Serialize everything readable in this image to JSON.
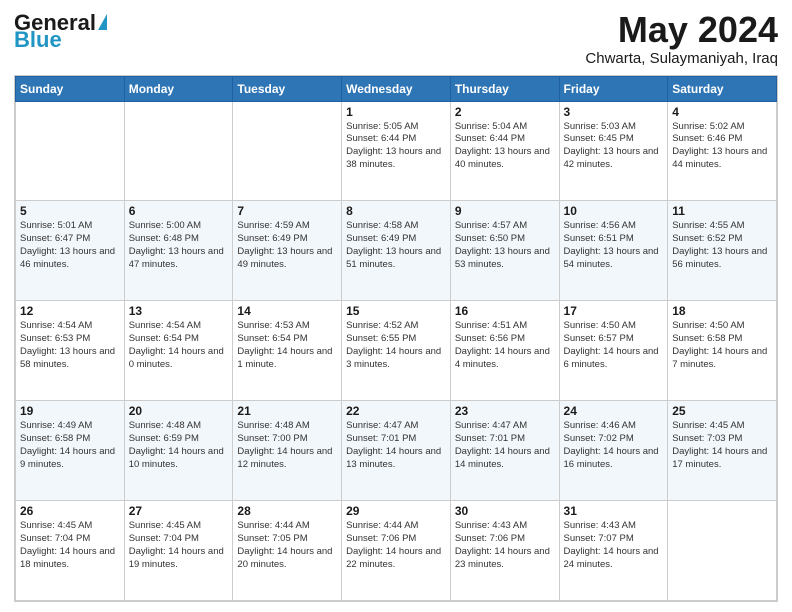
{
  "header": {
    "logo_general": "General",
    "logo_blue": "Blue",
    "month_title": "May 2024",
    "location": "Chwarta, Sulaymaniyah, Iraq"
  },
  "calendar": {
    "headers": [
      "Sunday",
      "Monday",
      "Tuesday",
      "Wednesday",
      "Thursday",
      "Friday",
      "Saturday"
    ],
    "rows": [
      [
        {
          "day": "",
          "info": ""
        },
        {
          "day": "",
          "info": ""
        },
        {
          "day": "",
          "info": ""
        },
        {
          "day": "1",
          "info": "Sunrise: 5:05 AM\nSunset: 6:44 PM\nDaylight: 13 hours and 38 minutes."
        },
        {
          "day": "2",
          "info": "Sunrise: 5:04 AM\nSunset: 6:44 PM\nDaylight: 13 hours and 40 minutes."
        },
        {
          "day": "3",
          "info": "Sunrise: 5:03 AM\nSunset: 6:45 PM\nDaylight: 13 hours and 42 minutes."
        },
        {
          "day": "4",
          "info": "Sunrise: 5:02 AM\nSunset: 6:46 PM\nDaylight: 13 hours and 44 minutes."
        }
      ],
      [
        {
          "day": "5",
          "info": "Sunrise: 5:01 AM\nSunset: 6:47 PM\nDaylight: 13 hours and 46 minutes."
        },
        {
          "day": "6",
          "info": "Sunrise: 5:00 AM\nSunset: 6:48 PM\nDaylight: 13 hours and 47 minutes."
        },
        {
          "day": "7",
          "info": "Sunrise: 4:59 AM\nSunset: 6:49 PM\nDaylight: 13 hours and 49 minutes."
        },
        {
          "day": "8",
          "info": "Sunrise: 4:58 AM\nSunset: 6:49 PM\nDaylight: 13 hours and 51 minutes."
        },
        {
          "day": "9",
          "info": "Sunrise: 4:57 AM\nSunset: 6:50 PM\nDaylight: 13 hours and 53 minutes."
        },
        {
          "day": "10",
          "info": "Sunrise: 4:56 AM\nSunset: 6:51 PM\nDaylight: 13 hours and 54 minutes."
        },
        {
          "day": "11",
          "info": "Sunrise: 4:55 AM\nSunset: 6:52 PM\nDaylight: 13 hours and 56 minutes."
        }
      ],
      [
        {
          "day": "12",
          "info": "Sunrise: 4:54 AM\nSunset: 6:53 PM\nDaylight: 13 hours and 58 minutes."
        },
        {
          "day": "13",
          "info": "Sunrise: 4:54 AM\nSunset: 6:54 PM\nDaylight: 14 hours and 0 minutes."
        },
        {
          "day": "14",
          "info": "Sunrise: 4:53 AM\nSunset: 6:54 PM\nDaylight: 14 hours and 1 minute."
        },
        {
          "day": "15",
          "info": "Sunrise: 4:52 AM\nSunset: 6:55 PM\nDaylight: 14 hours and 3 minutes."
        },
        {
          "day": "16",
          "info": "Sunrise: 4:51 AM\nSunset: 6:56 PM\nDaylight: 14 hours and 4 minutes."
        },
        {
          "day": "17",
          "info": "Sunrise: 4:50 AM\nSunset: 6:57 PM\nDaylight: 14 hours and 6 minutes."
        },
        {
          "day": "18",
          "info": "Sunrise: 4:50 AM\nSunset: 6:58 PM\nDaylight: 14 hours and 7 minutes."
        }
      ],
      [
        {
          "day": "19",
          "info": "Sunrise: 4:49 AM\nSunset: 6:58 PM\nDaylight: 14 hours and 9 minutes."
        },
        {
          "day": "20",
          "info": "Sunrise: 4:48 AM\nSunset: 6:59 PM\nDaylight: 14 hours and 10 minutes."
        },
        {
          "day": "21",
          "info": "Sunrise: 4:48 AM\nSunset: 7:00 PM\nDaylight: 14 hours and 12 minutes."
        },
        {
          "day": "22",
          "info": "Sunrise: 4:47 AM\nSunset: 7:01 PM\nDaylight: 14 hours and 13 minutes."
        },
        {
          "day": "23",
          "info": "Sunrise: 4:47 AM\nSunset: 7:01 PM\nDaylight: 14 hours and 14 minutes."
        },
        {
          "day": "24",
          "info": "Sunrise: 4:46 AM\nSunset: 7:02 PM\nDaylight: 14 hours and 16 minutes."
        },
        {
          "day": "25",
          "info": "Sunrise: 4:45 AM\nSunset: 7:03 PM\nDaylight: 14 hours and 17 minutes."
        }
      ],
      [
        {
          "day": "26",
          "info": "Sunrise: 4:45 AM\nSunset: 7:04 PM\nDaylight: 14 hours and 18 minutes."
        },
        {
          "day": "27",
          "info": "Sunrise: 4:45 AM\nSunset: 7:04 PM\nDaylight: 14 hours and 19 minutes."
        },
        {
          "day": "28",
          "info": "Sunrise: 4:44 AM\nSunset: 7:05 PM\nDaylight: 14 hours and 20 minutes."
        },
        {
          "day": "29",
          "info": "Sunrise: 4:44 AM\nSunset: 7:06 PM\nDaylight: 14 hours and 22 minutes."
        },
        {
          "day": "30",
          "info": "Sunrise: 4:43 AM\nSunset: 7:06 PM\nDaylight: 14 hours and 23 minutes."
        },
        {
          "day": "31",
          "info": "Sunrise: 4:43 AM\nSunset: 7:07 PM\nDaylight: 14 hours and 24 minutes."
        },
        {
          "day": "",
          "info": ""
        }
      ]
    ]
  }
}
